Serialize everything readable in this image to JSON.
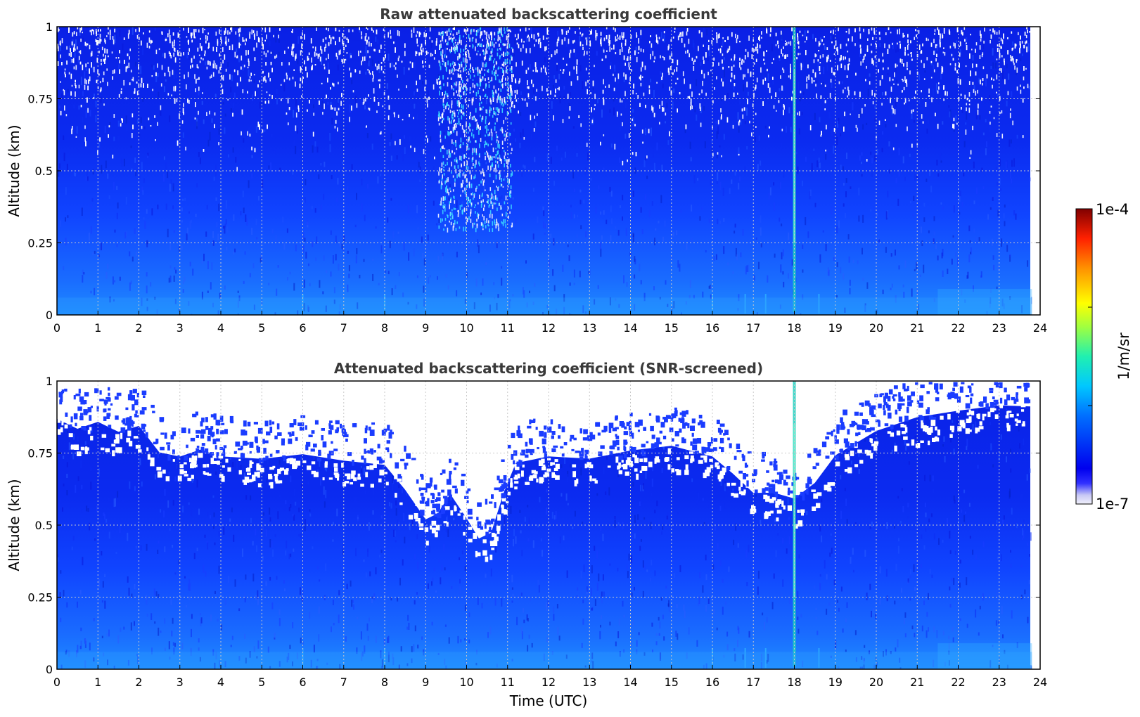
{
  "chart_data": [
    {
      "type": "heatmap",
      "title": "Raw attenuated backscattering coefficient",
      "xlabel": "",
      "ylabel": "Altitude (km)",
      "xlim": [
        0,
        24
      ],
      "ylim": [
        0,
        1
      ],
      "xticks": [
        "0",
        "1",
        "2",
        "3",
        "4",
        "5",
        "6",
        "7",
        "8",
        "9",
        "10",
        "11",
        "12",
        "13",
        "14",
        "15",
        "16",
        "17",
        "18",
        "19",
        "20",
        "21",
        "22",
        "23",
        "24"
      ],
      "yticks": [
        "0",
        "0.25",
        "0.5",
        "0.75",
        "1"
      ],
      "grid": true,
      "data_end_time": 23.8,
      "features": {
        "background_level": "blue",
        "noise_above_km": 0.5,
        "noisy_period_hours": [
          9.5,
          11
        ],
        "vertical_spike_hour": 18,
        "near_surface_light_layer_km": 0.05
      }
    },
    {
      "type": "heatmap",
      "title": "Attenuated backscattering coefficient (SNR-screened)",
      "xlabel": "Time (UTC)",
      "ylabel": "Altitude (km)",
      "xlim": [
        0,
        24
      ],
      "ylim": [
        0,
        1
      ],
      "xticks": [
        "0",
        "1",
        "2",
        "3",
        "4",
        "5",
        "6",
        "7",
        "8",
        "9",
        "10",
        "11",
        "12",
        "13",
        "14",
        "15",
        "16",
        "17",
        "18",
        "19",
        "20",
        "21",
        "22",
        "23",
        "24"
      ],
      "yticks": [
        "0",
        "0.25",
        "0.5",
        "0.75",
        "1"
      ],
      "grid": true,
      "data_end_time": 23.8,
      "screened_boundary_km": [
        [
          0.0,
          0.88
        ],
        [
          0.5,
          0.83
        ],
        [
          1.0,
          0.85
        ],
        [
          1.5,
          0.82
        ],
        [
          2.0,
          0.84
        ],
        [
          2.5,
          0.75
        ],
        [
          3.0,
          0.73
        ],
        [
          3.5,
          0.76
        ],
        [
          4.0,
          0.74
        ],
        [
          5.0,
          0.72
        ],
        [
          6.0,
          0.74
        ],
        [
          7.0,
          0.72
        ],
        [
          8.0,
          0.72
        ],
        [
          8.5,
          0.63
        ],
        [
          9.0,
          0.52
        ],
        [
          9.3,
          0.53
        ],
        [
          9.6,
          0.6
        ],
        [
          10.0,
          0.52
        ],
        [
          10.3,
          0.46
        ],
        [
          10.6,
          0.47
        ],
        [
          10.9,
          0.62
        ],
        [
          11.2,
          0.72
        ],
        [
          12.0,
          0.74
        ],
        [
          13.0,
          0.72
        ],
        [
          14.0,
          0.75
        ],
        [
          15.0,
          0.77
        ],
        [
          16.0,
          0.74
        ],
        [
          16.5,
          0.68
        ],
        [
          17.0,
          0.62
        ],
        [
          17.5,
          0.6
        ],
        [
          18.0,
          0.58
        ],
        [
          18.5,
          0.64
        ],
        [
          19.0,
          0.74
        ],
        [
          20.0,
          0.84
        ],
        [
          21.0,
          0.86
        ],
        [
          22.0,
          0.9
        ],
        [
          23.0,
          0.92
        ],
        [
          23.8,
          0.92
        ]
      ]
    }
  ],
  "colorbar": {
    "label": "1/m/sr",
    "max_label": "1e-4",
    "min_label": "1e-7",
    "scale": "log",
    "range": [
      1e-07,
      0.0001
    ],
    "colormap": "jet"
  }
}
